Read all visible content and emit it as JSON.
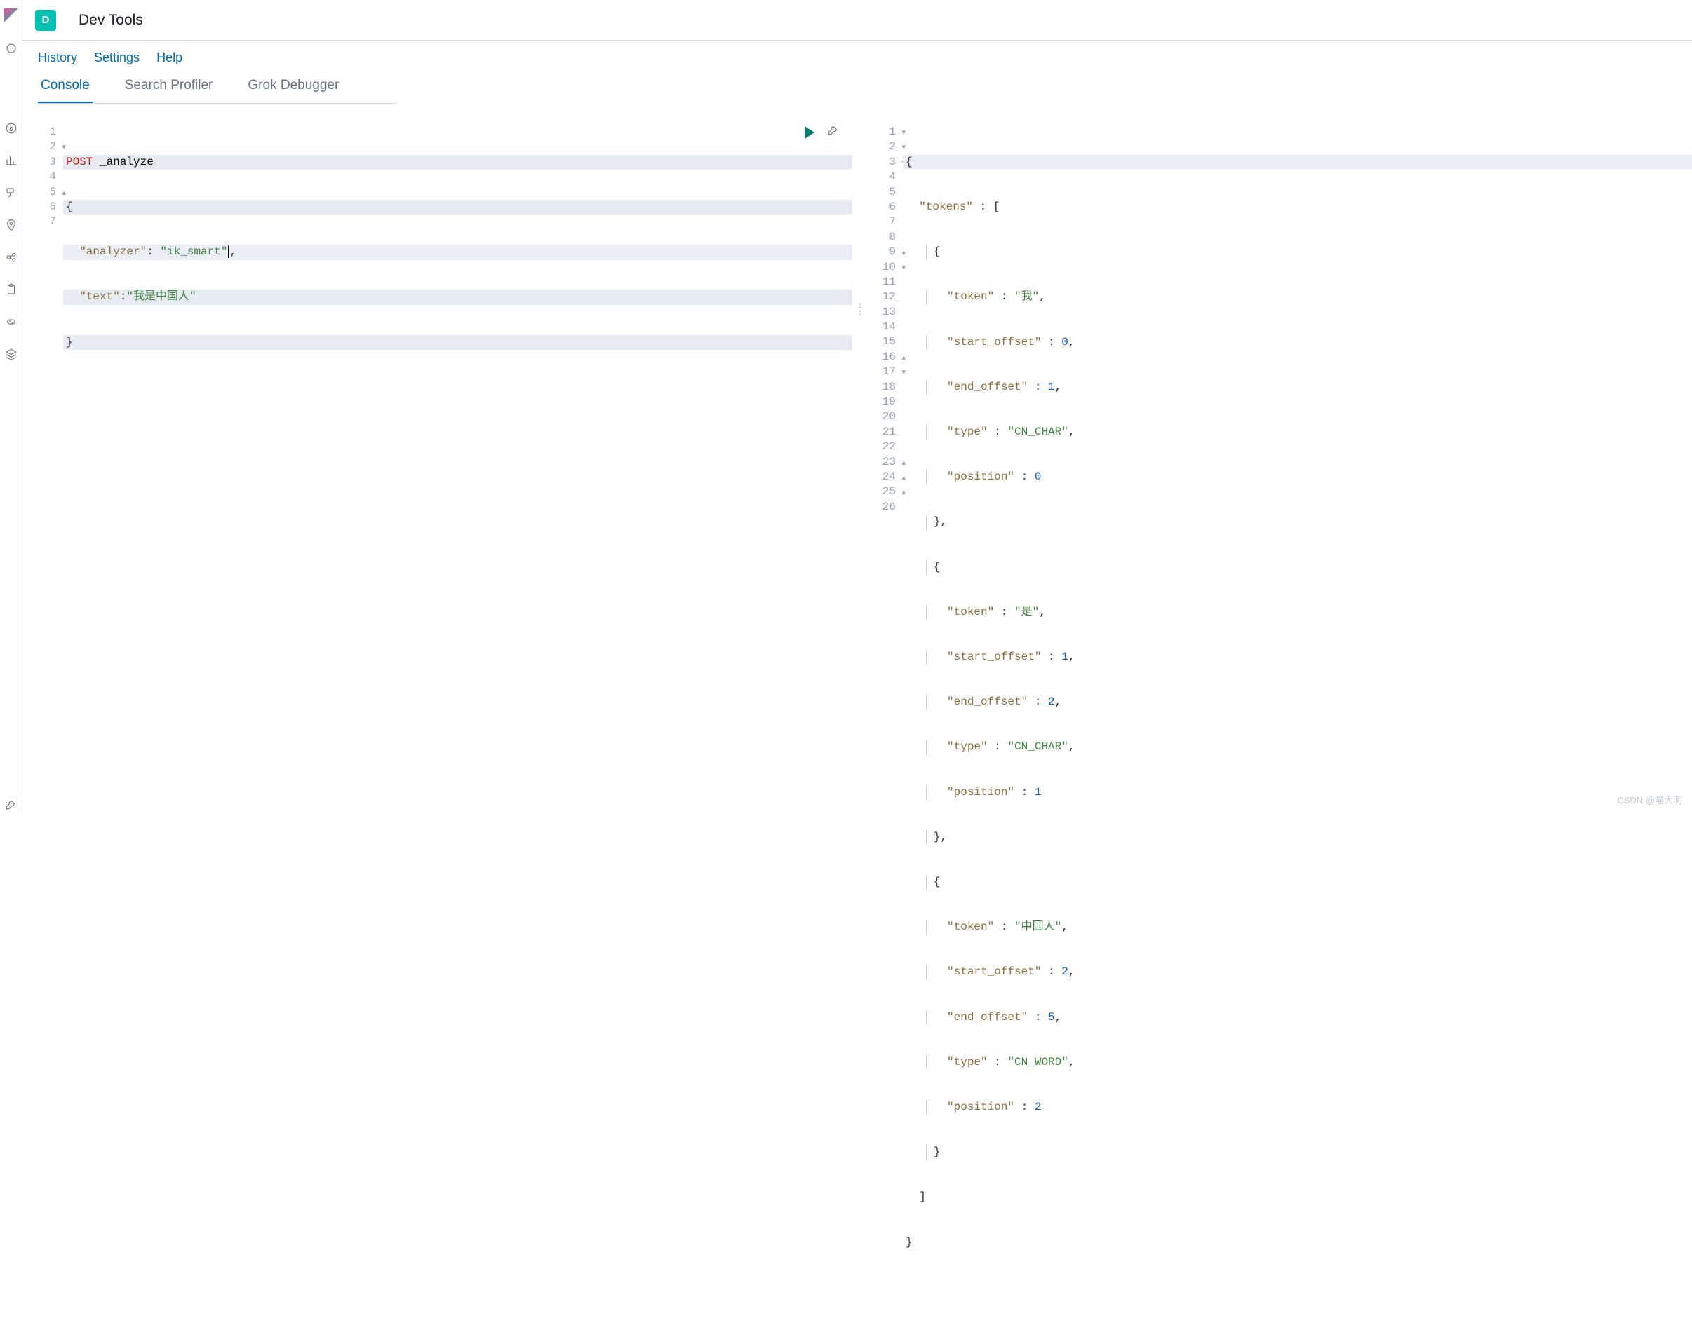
{
  "space_badge": "D",
  "page_title": "Dev Tools",
  "links": {
    "history": "History",
    "settings": "Settings",
    "help": "Help"
  },
  "tabs": {
    "console": "Console",
    "search_profiler": "Search Profiler",
    "grok_debugger": "Grok Debugger"
  },
  "request": {
    "method": "POST",
    "path": "_analyze",
    "body_keys": {
      "analyzer": "\"analyzer\"",
      "text": "\"text\""
    },
    "body_vals": {
      "analyzer": "\"ik_smart\"",
      "text": "\"我是中国人\""
    }
  },
  "response": {
    "root_key": "\"tokens\"",
    "tokens": [
      {
        "token": "\"我\"",
        "start_offset": "0",
        "end_offset": "1",
        "type": "\"CN_CHAR\"",
        "position": "0"
      },
      {
        "token": "\"是\"",
        "start_offset": "1",
        "end_offset": "2",
        "type": "\"CN_CHAR\"",
        "position": "1"
      },
      {
        "token": "\"中国人\"",
        "start_offset": "2",
        "end_offset": "5",
        "type": "\"CN_WORD\"",
        "position": "2"
      }
    ],
    "keys": {
      "token": "\"token\"",
      "start_offset": "\"start_offset\"",
      "end_offset": "\"end_offset\"",
      "type": "\"type\"",
      "position": "\"position\""
    }
  },
  "gutters": {
    "req": [
      "1",
      "2",
      "3",
      "4",
      "5",
      "6",
      "7"
    ],
    "resp": [
      "1",
      "2",
      "3",
      "4",
      "5",
      "6",
      "7",
      "8",
      "9",
      "10",
      "11",
      "12",
      "13",
      "14",
      "15",
      "16",
      "17",
      "18",
      "19",
      "20",
      "21",
      "22",
      "23",
      "24",
      "25",
      "26"
    ]
  },
  "watermark": "CSDN @喵大明"
}
